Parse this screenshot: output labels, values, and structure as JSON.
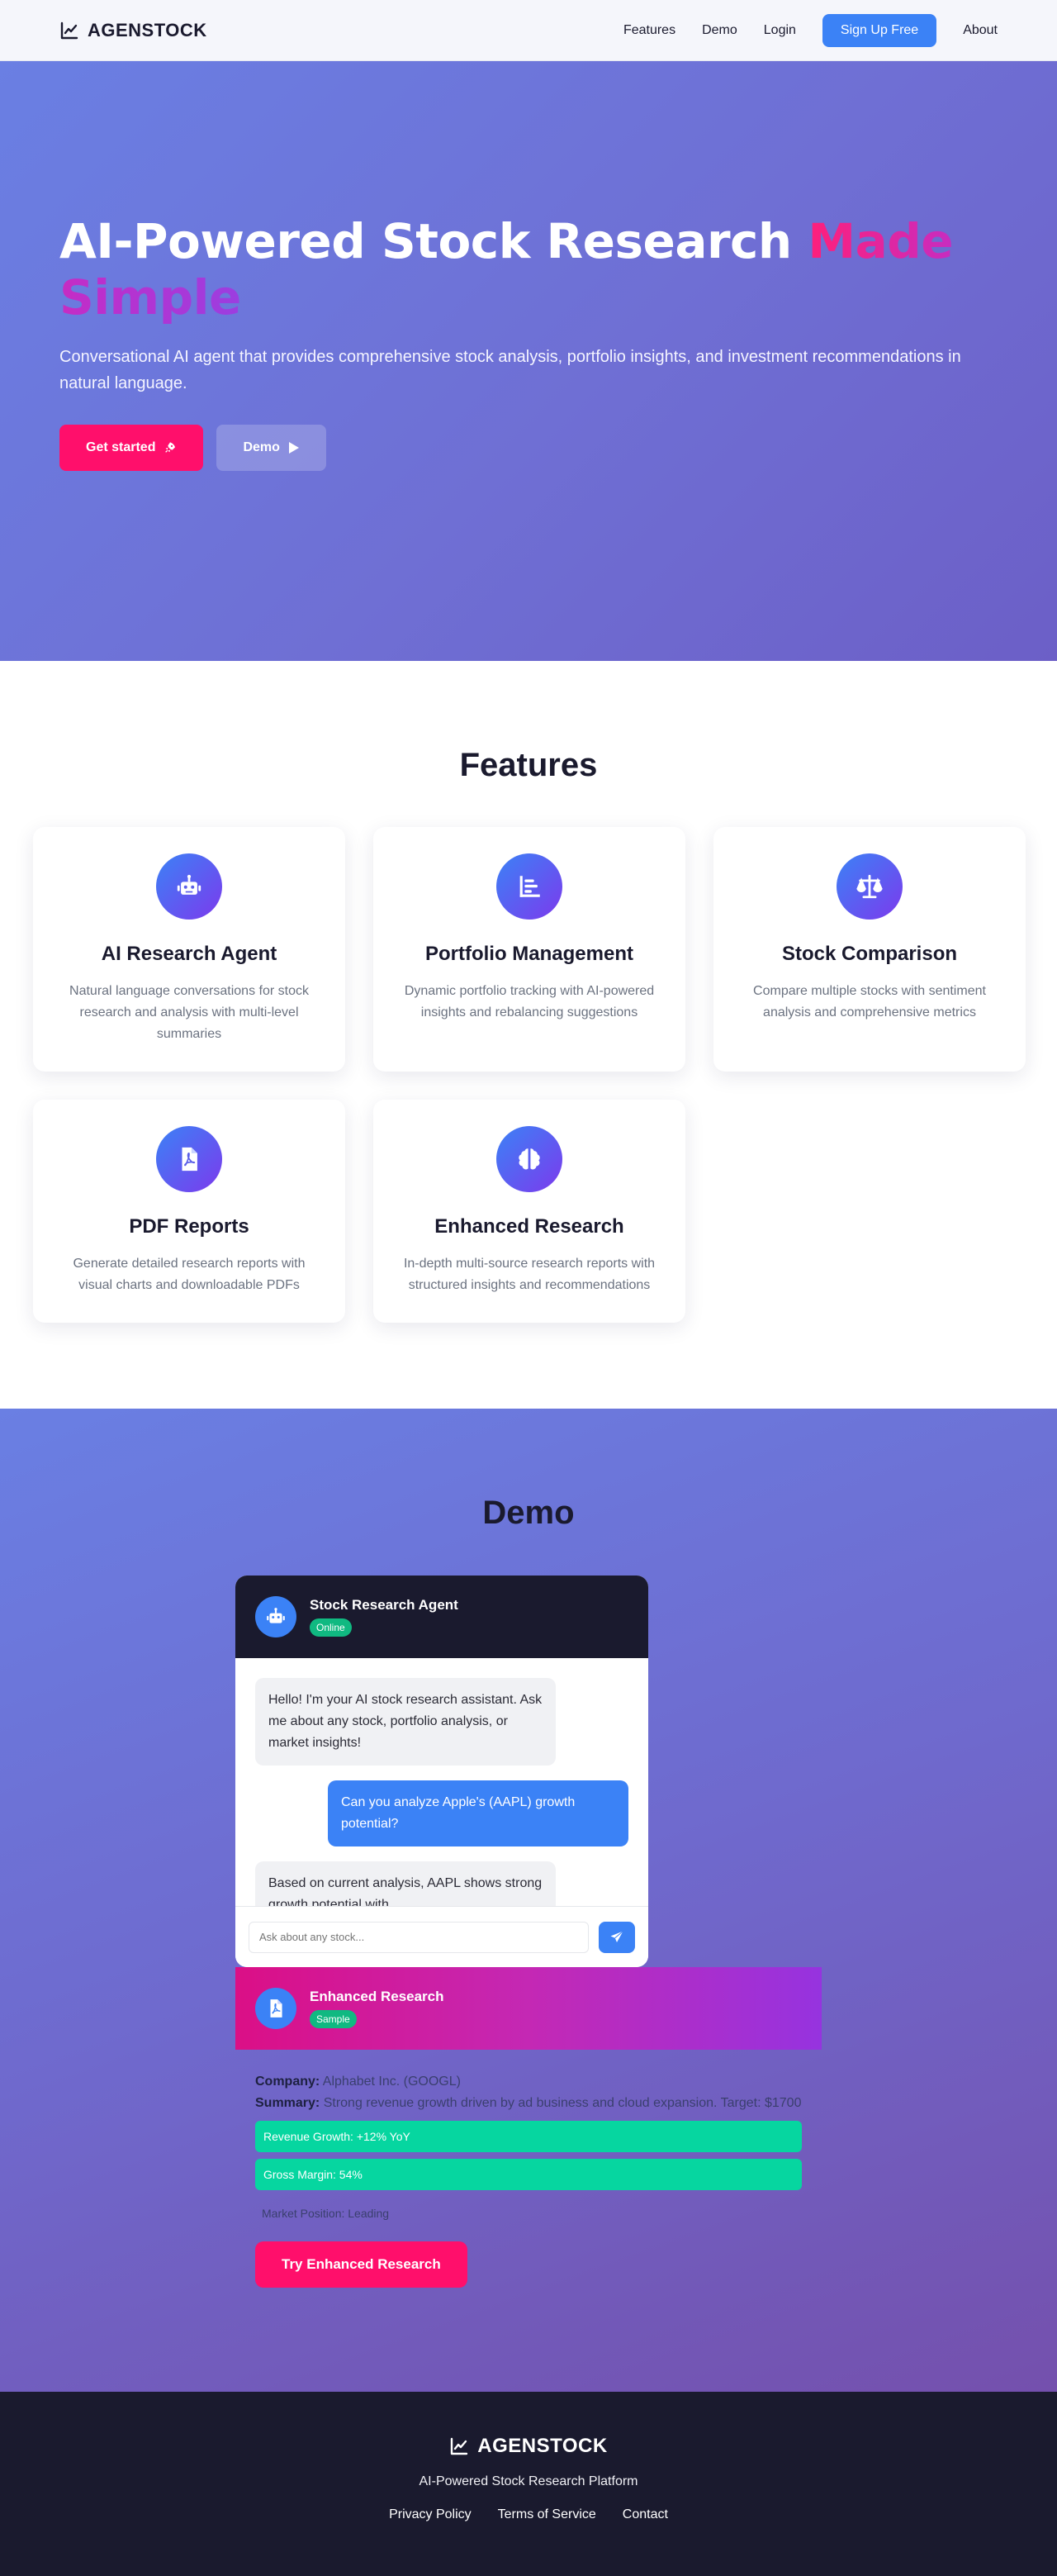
{
  "nav": {
    "brand": "AGENSTOCK",
    "links": [
      "Features",
      "Demo",
      "Login"
    ],
    "signup": "Sign Up Free",
    "about": "About"
  },
  "hero": {
    "title_main": "AI-Powered Stock Research ",
    "title_highlight": "Made Simple",
    "subtitle": "Conversational AI agent that provides comprehensive stock analysis, portfolio insights, and investment recommendations in natural language.",
    "primary_button": "Get started",
    "secondary_button": "Demo"
  },
  "features": {
    "title": "Features",
    "items": [
      {
        "icon": "robot-icon",
        "title": "AI Research Agent",
        "desc": "Natural language conversations for stock research and analysis with multi-level summaries"
      },
      {
        "icon": "chart-bar-icon",
        "title": "Portfolio Management",
        "desc": "Dynamic portfolio tracking with AI-powered insights and rebalancing suggestions"
      },
      {
        "icon": "balance-scale-icon",
        "title": "Stock Comparison",
        "desc": "Compare multiple stocks with sentiment analysis and comprehensive metrics"
      },
      {
        "icon": "pdf-file-icon",
        "title": "PDF Reports",
        "desc": "Generate detailed research reports with visual charts and downloadable PDFs"
      },
      {
        "icon": "brain-icon",
        "title": "Enhanced Research",
        "desc": "In-depth multi-source research reports with structured insights and recommendations"
      }
    ]
  },
  "demo": {
    "title": "Demo",
    "chat": {
      "agent_name": "Stock Research Agent",
      "status": "Online",
      "messages": [
        {
          "role": "ai",
          "text": "Hello! I'm your AI stock research assistant. Ask me about any stock, portfolio analysis, or market insights!"
        },
        {
          "role": "user",
          "text": "Can you analyze Apple's (AAPL) growth potential?"
        },
        {
          "role": "ai",
          "text": "Based on current analysis, AAPL shows strong growth potential with..."
        }
      ],
      "input_placeholder": "Ask about any stock..."
    },
    "research": {
      "title": "Enhanced Research",
      "badge": "Sample",
      "company_label": "Company:",
      "company": "Alphabet Inc. (GOOGL)",
      "summary_label": "Summary:",
      "summary": "Strong revenue growth driven by ad business and cloud expansion. Target: $1700",
      "metrics": [
        "Revenue Growth: +12% YoY",
        "Gross Margin: 54%"
      ],
      "market_position": "Market Position: Leading",
      "button": "Try Enhanced Research"
    }
  },
  "footer": {
    "brand": "AGENSTOCK",
    "tagline": "AI-Powered Stock Research Platform",
    "links": [
      "Privacy Policy",
      "Terms of Service",
      "Contact"
    ]
  }
}
